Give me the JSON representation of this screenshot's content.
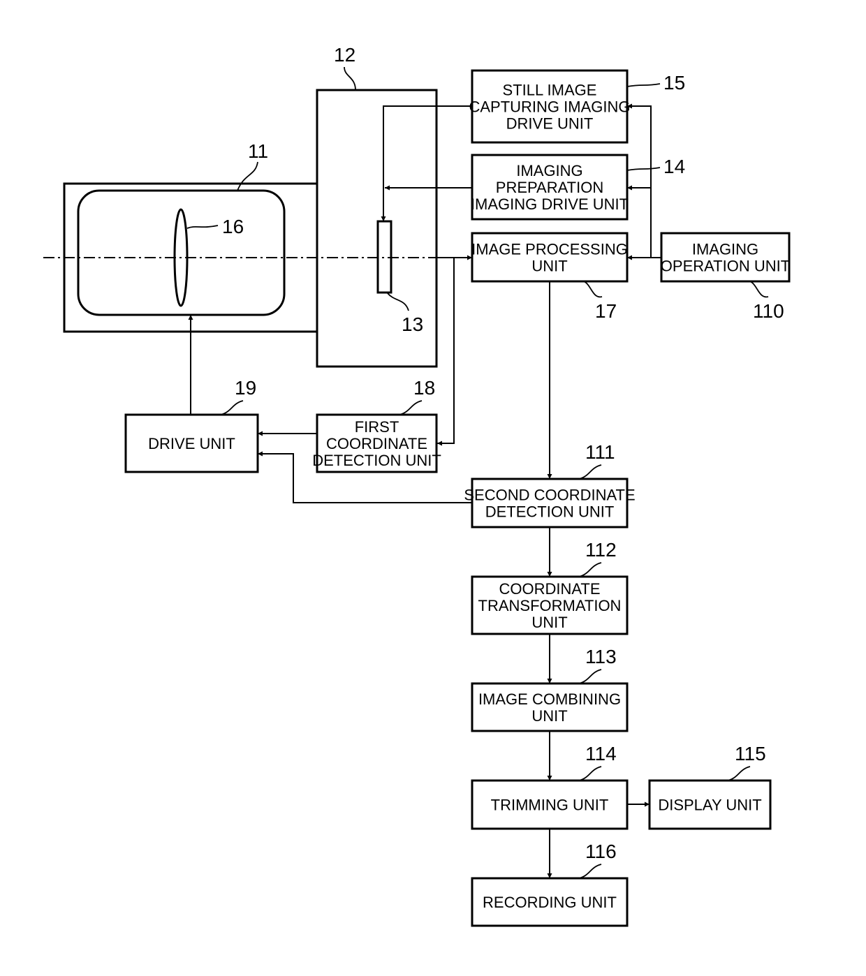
{
  "diagram": {
    "type": "block-diagram",
    "blocks": {
      "still_image_drive": {
        "ref": "15",
        "lines": [
          "STILL IMAGE",
          "CAPTURING IMAGING",
          "DRIVE UNIT"
        ]
      },
      "imaging_prep_drive": {
        "ref": "14",
        "lines": [
          "IMAGING",
          "PREPARATION",
          "IMAGING DRIVE UNIT"
        ]
      },
      "image_processing": {
        "ref": "17",
        "lines": [
          "IMAGE PROCESSING",
          "UNIT"
        ]
      },
      "imaging_operation": {
        "ref": "110",
        "lines": [
          "IMAGING",
          "OPERATION UNIT"
        ]
      },
      "drive_unit": {
        "ref": "19",
        "lines": [
          "DRIVE UNIT"
        ]
      },
      "first_coord": {
        "ref": "18",
        "lines": [
          "FIRST",
          "COORDINATE",
          "DETECTION UNIT"
        ]
      },
      "second_coord": {
        "ref": "111",
        "lines": [
          "SECOND COORDINATE",
          "DETECTION UNIT"
        ]
      },
      "coord_transform": {
        "ref": "112",
        "lines": [
          "COORDINATE",
          "TRANSFORMATION",
          "UNIT"
        ]
      },
      "image_combining": {
        "ref": "113",
        "lines": [
          "IMAGE COMBINING",
          "UNIT"
        ]
      },
      "trimming": {
        "ref": "114",
        "lines": [
          "TRIMMING UNIT"
        ]
      },
      "display": {
        "ref": "115",
        "lines": [
          "DISPLAY UNIT"
        ]
      },
      "recording": {
        "ref": "116",
        "lines": [
          "RECORDING UNIT"
        ]
      }
    },
    "components": {
      "lens_barrel": {
        "ref": "11"
      },
      "camera_body": {
        "ref": "12"
      },
      "image_sensor": {
        "ref": "13"
      },
      "lens": {
        "ref": "16"
      }
    },
    "connections": [
      [
        "imaging_operation",
        "image_processing"
      ],
      [
        "imaging_operation",
        "imaging_prep_drive"
      ],
      [
        "imaging_operation",
        "still_image_drive"
      ],
      [
        "still_image_drive",
        "image_sensor"
      ],
      [
        "imaging_prep_drive",
        "image_sensor"
      ],
      [
        "image_sensor",
        "image_processing"
      ],
      [
        "image_sensor",
        "first_coord"
      ],
      [
        "first_coord",
        "drive_unit"
      ],
      [
        "second_coord",
        "drive_unit"
      ],
      [
        "drive_unit",
        "lens"
      ],
      [
        "image_processing",
        "second_coord"
      ],
      [
        "second_coord",
        "coord_transform"
      ],
      [
        "coord_transform",
        "image_combining"
      ],
      [
        "image_combining",
        "trimming"
      ],
      [
        "trimming",
        "display"
      ],
      [
        "trimming",
        "recording"
      ]
    ]
  }
}
